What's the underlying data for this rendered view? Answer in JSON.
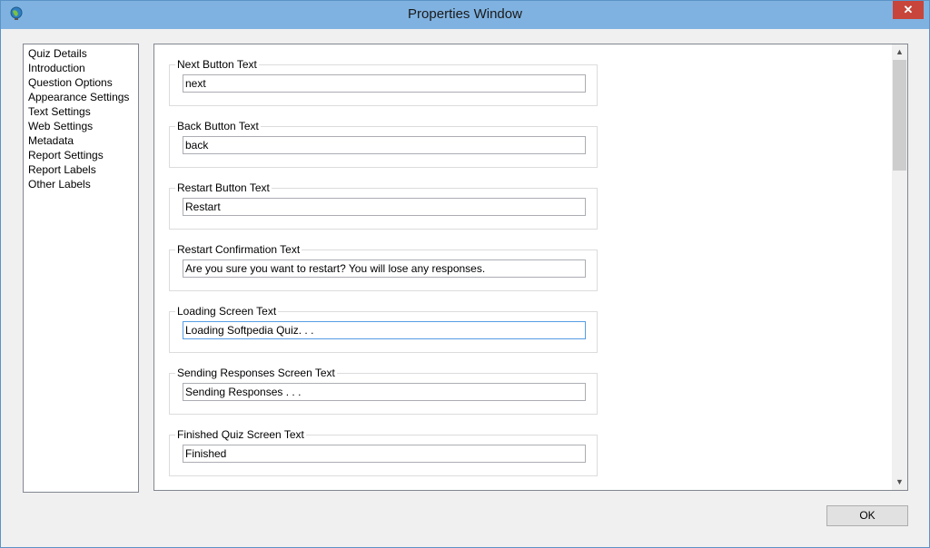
{
  "window": {
    "title": "Properties Window",
    "close_glyph": "✕"
  },
  "nav": {
    "items": [
      {
        "label": "Quiz Details"
      },
      {
        "label": "Introduction"
      },
      {
        "label": "Question Options"
      },
      {
        "label": "Appearance Settings"
      },
      {
        "label": "Text Settings"
      },
      {
        "label": "Web Settings"
      },
      {
        "label": "Metadata"
      },
      {
        "label": "Report Settings"
      },
      {
        "label": "Report Labels"
      },
      {
        "label": "Other Labels"
      }
    ]
  },
  "fields": [
    {
      "label": "Next Button Text",
      "value": "next"
    },
    {
      "label": "Back Button Text",
      "value": "back"
    },
    {
      "label": "Restart Button Text",
      "value": "Restart"
    },
    {
      "label": "Restart Confirmation Text",
      "value": "Are you sure you want to restart? You will lose any responses."
    },
    {
      "label": "Loading Screen Text",
      "value": "Loading Softpedia Quiz. . ."
    },
    {
      "label": "Sending Responses Screen Text",
      "value": "Sending Responses . . ."
    },
    {
      "label": "Finished Quiz Screen Text",
      "value": "Finished"
    }
  ],
  "scrollbar": {
    "up_glyph": "▲",
    "down_glyph": "▼",
    "position_fraction": 0.0
  },
  "footer": {
    "ok_label": "OK"
  },
  "icons": {
    "app": "globe-icon",
    "close": "close-icon"
  }
}
